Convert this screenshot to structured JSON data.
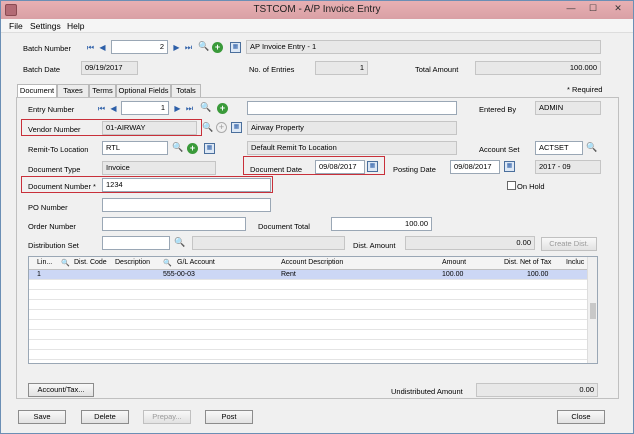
{
  "window": {
    "title": "TSTCOM - A/P Invoice Entry",
    "minimize": "—",
    "maximize": "☐",
    "close": "✕"
  },
  "menu": {
    "file": "File",
    "settings": "Settings",
    "help": "Help"
  },
  "batch": {
    "number_label": "Batch Number",
    "number": "2",
    "description": "AP Invoice Entry - 1",
    "date_label": "Batch Date",
    "date": "09/19/2017",
    "entries_label": "No. of Entries",
    "entries": "1",
    "total_label": "Total Amount",
    "total": "100.000"
  },
  "required_note": "* Required",
  "tabs": [
    "Document",
    "Taxes",
    "Terms",
    "Optional Fields",
    "Totals"
  ],
  "document": {
    "entry_label": "Entry Number",
    "entry": "1",
    "entry_desc": "",
    "entered_by_label": "Entered By",
    "entered_by": "ADMIN",
    "vendor_label": "Vendor Number",
    "vendor": "01-AIRWAY",
    "vendor_name": "Airway Property",
    "remit_label": "Remit-To Location",
    "remit": "RTL",
    "remit_desc": "Default Remit To Location",
    "account_set_label": "Account Set",
    "account_set": "ACTSET",
    "doc_type_label": "Document Type",
    "doc_type": "Invoice",
    "doc_date_label": "Document Date",
    "doc_date": "09/08/2017",
    "posting_date_label": "Posting Date",
    "posting_date": "09/08/2017",
    "period": "2017 - 09",
    "doc_number_label": "Document Number *",
    "doc_number": "1234",
    "on_hold_label": "On Hold",
    "po_label": "PO Number",
    "po": "",
    "order_label": "Order Number",
    "order": "",
    "doc_total_label": "Document Total",
    "doc_total": "100.00",
    "dist_set_label": "Distribution Set",
    "dist_set": "",
    "dist_amount_label": "Dist. Amount",
    "dist_amount": "0.00",
    "create_dist": "Create Dist."
  },
  "grid": {
    "headers": [
      "Lin...",
      "Dist. Code",
      "Description",
      "G/L Account",
      "Account Description",
      "Amount",
      "Dist. Net of Tax",
      "Incluc"
    ],
    "rows": [
      {
        "line": "1",
        "dist_code": "",
        "description": "",
        "gl_account": "555-00-03",
        "account_desc": "Rent",
        "amount": "100.00",
        "net_of_tax": "100.00"
      }
    ]
  },
  "account_tax_button": "Account/Tax...",
  "undistributed_label": "Undistributed Amount",
  "undistributed": "0.00",
  "footer": {
    "save": "Save",
    "delete": "Delete",
    "prepay": "Prepay...",
    "post": "Post",
    "close": "Close"
  }
}
